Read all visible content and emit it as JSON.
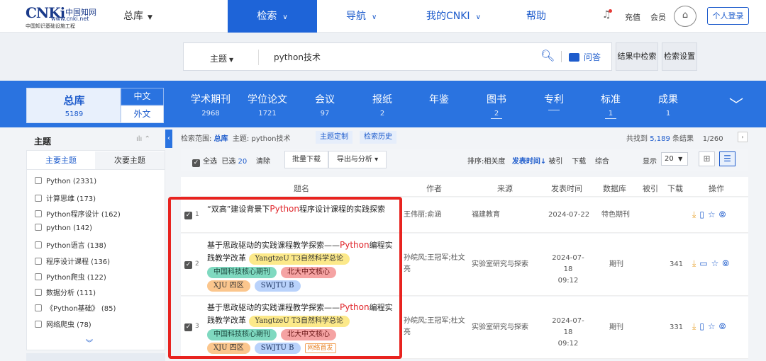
{
  "header": {
    "logo_big": "CNKi",
    "logo_cn": "中国知网",
    "logo_url": "www.cnki.net",
    "logo_sub": "中国知识基础设施工程",
    "library": "总库",
    "nav": [
      {
        "label": "检索",
        "active": true
      },
      {
        "label": "导航",
        "active": false
      },
      {
        "label": "我的CNKI",
        "active": false
      },
      {
        "label": "帮助",
        "active": false
      }
    ],
    "recharge": "充值",
    "member": "会员",
    "login": "个人登录"
  },
  "search": {
    "field": "主题",
    "query": "python技术",
    "qa": "问答",
    "within": "结果中检索",
    "settings": "检索设置"
  },
  "band": {
    "total_label": "总库",
    "total_count": "5189",
    "zh": "中文",
    "foreign": "外文",
    "categories": [
      {
        "name": "学术期刊",
        "count": "2968"
      },
      {
        "name": "学位论文",
        "count": "1721"
      },
      {
        "name": "会议",
        "count": "97"
      },
      {
        "name": "报纸",
        "count": "2"
      },
      {
        "name": "年鉴",
        "count": ""
      },
      {
        "name": "图书",
        "count": "2"
      },
      {
        "name": "专利",
        "count": ""
      },
      {
        "name": "标准",
        "count": "1"
      },
      {
        "name": "成果",
        "count": "1"
      }
    ]
  },
  "facets": {
    "title": "主题",
    "tab_main": "主要主题",
    "tab_sub": "次要主题",
    "items": [
      "Python (2331)",
      "计算思维 (173)",
      "Python程序设计 (162)",
      "python (142)",
      "Python语言 (138)",
      "程序设计课程 (136)",
      "Python爬虫 (122)",
      "数据分析 (111)",
      "《Python基础》 (85)",
      "网络爬虫 (78)"
    ]
  },
  "results": {
    "scope_label": "检索范围:",
    "scope_lib": "总库",
    "scope_query": "主题: python技术",
    "btn_custom": "主题定制",
    "btn_history": "检索历史",
    "found_prefix": "共找到",
    "found_count": "5,189",
    "found_suffix": "条结果",
    "page": "1/260",
    "select_all": "全选",
    "selected_label": "已选",
    "selected_count": "20",
    "clear": "清除",
    "bulk_download": "批量下载",
    "export": "导出与分析",
    "sort_label": "排序:",
    "sort_relevance": "相关度",
    "sort_time": "发表时间",
    "sort_cited": "被引",
    "sort_download": "下载",
    "sort_overall": "综合",
    "show_label": "显示",
    "page_size": "20",
    "columns": [
      "题名",
      "作者",
      "来源",
      "发表时间",
      "数据库",
      "被引",
      "下载",
      "操作"
    ],
    "rows": [
      {
        "num": "1",
        "title_pre": "“双高”建设背景下",
        "title_hl": "Python",
        "title_post": "程序设计课程的实践探索",
        "author": "王伟丽;俞涵",
        "source": "福建教育",
        "date": "2024-07-22",
        "time": "",
        "db": "特色期刊",
        "cited": "",
        "downloads": ""
      },
      {
        "num": "2",
        "title_pre": "基于思政驱动的实践课程教学探索——",
        "title_hl": "Python",
        "title_post": "编程实践教学改革",
        "tags": [
          "YangtzeU T3自然科学总论",
          "中国科技核心期刊",
          "北大中文核心",
          "XJU 四区",
          "SWJTU B"
        ],
        "author": "孙皖风;王冠军;杜文亮",
        "source": "实验室研究与探索",
        "date": "2024-07-18",
        "time": "09:12",
        "db": "期刊",
        "cited": "",
        "downloads": "341"
      },
      {
        "num": "3",
        "title_pre": "基于思政驱动的实践课程教学探索——",
        "title_hl": "Python",
        "title_post": "编程实践教学改革",
        "tags": [
          "YangtzeU T3自然科学总论",
          "中国科技核心期刊",
          "北大中文核心",
          "XJU 四区",
          "SWJTU B"
        ],
        "new_badge": "网络首发",
        "author": "孙皖风;王冠军;杜文亮",
        "source": "实验室研究与探索",
        "date": "2024-07-18",
        "time": "09:12",
        "db": "期刊",
        "cited": "",
        "downloads": "331"
      }
    ]
  }
}
